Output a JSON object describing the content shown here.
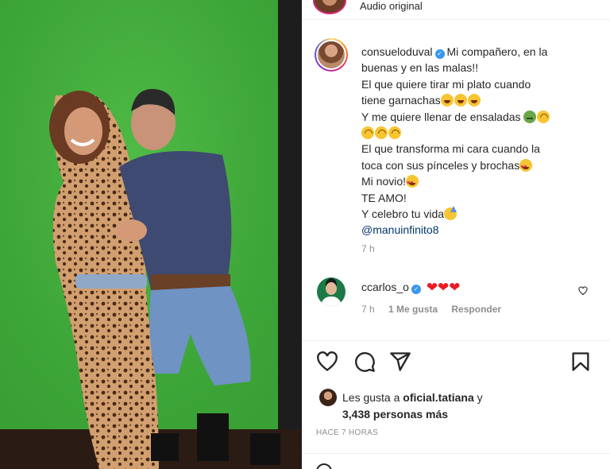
{
  "audio": {
    "label": "Audio original"
  },
  "caption": {
    "username": "consueloduval",
    "lines": [
      "Mi compañero, en la",
      "buenas y en las malas!!",
      "El que quiere tirar mi plato cuando",
      "tiene garnachas",
      "Y me quiere llenar de ensaladas",
      "El que transforma mi cara cuando la",
      "toca con sus pínceles y brochas",
      "Mi novio!",
      "TE AMO!",
      "Y celebro tu vida",
      "@manuinfinito8"
    ],
    "time": "7 h"
  },
  "comment": {
    "username": "ccarlos_o",
    "hearts": "❤❤❤",
    "time": "7 h",
    "likes": "1 Me gusta",
    "reply": "Responder"
  },
  "likes": {
    "prefix": "Les gusta a ",
    "user": "oficial.tatiana",
    "joiner": " y",
    "count": "3,438 personas más"
  },
  "posted": "HACE 7 HORAS",
  "icons": {
    "like": "heart-outline-icon",
    "comment": "comment-icon",
    "share": "paper-plane-icon",
    "save": "bookmark-icon",
    "verified": "verified-badge-icon"
  },
  "colors": {
    "link": "#00376b",
    "verified": "#3897f0",
    "muted": "#8e8e8e",
    "green_screen": "#3fae3a"
  }
}
